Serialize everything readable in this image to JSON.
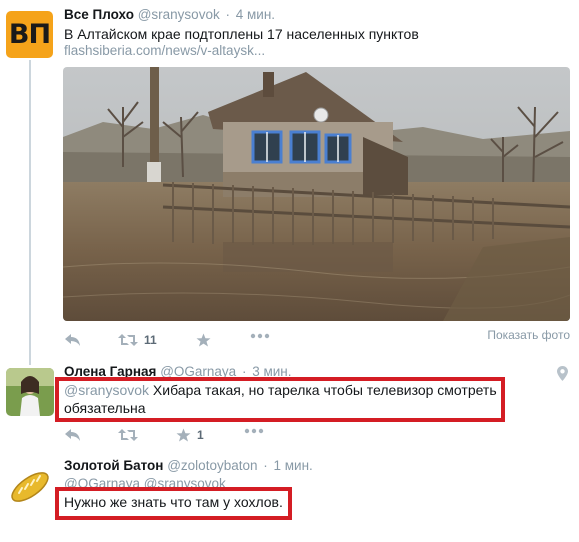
{
  "tweet1": {
    "avatar_text": "ВП",
    "name": "Все Плохо",
    "handle": "@sranysovok",
    "time": "4 мин.",
    "text": "В Алтайском крае подтоплены 17 населенных пунктов",
    "link": "flashsiberia.com/news/v-altaysk...",
    "retweets": "11",
    "show_photo": "Показать фото"
  },
  "tweet2": {
    "name": "Олена Гарная",
    "handle": "@OGarnaya",
    "time": "3 мин.",
    "mention": "@sranysovok",
    "text_line1": "Хибара такая, но тарелка чтобы телевизор смотреть",
    "text_line2": "обязательна",
    "likes": "1"
  },
  "tweet3": {
    "name": "Золотой Батон",
    "handle": "@zolotoybaton",
    "time": "1 мин.",
    "mentions": "@OGarnaya @sranysovok",
    "text": "Нужно же знать что там у хохлов."
  },
  "colors": {
    "highlight": "#d41d24",
    "muted": "#8899a6",
    "brand_orange": "#f5a31a"
  }
}
